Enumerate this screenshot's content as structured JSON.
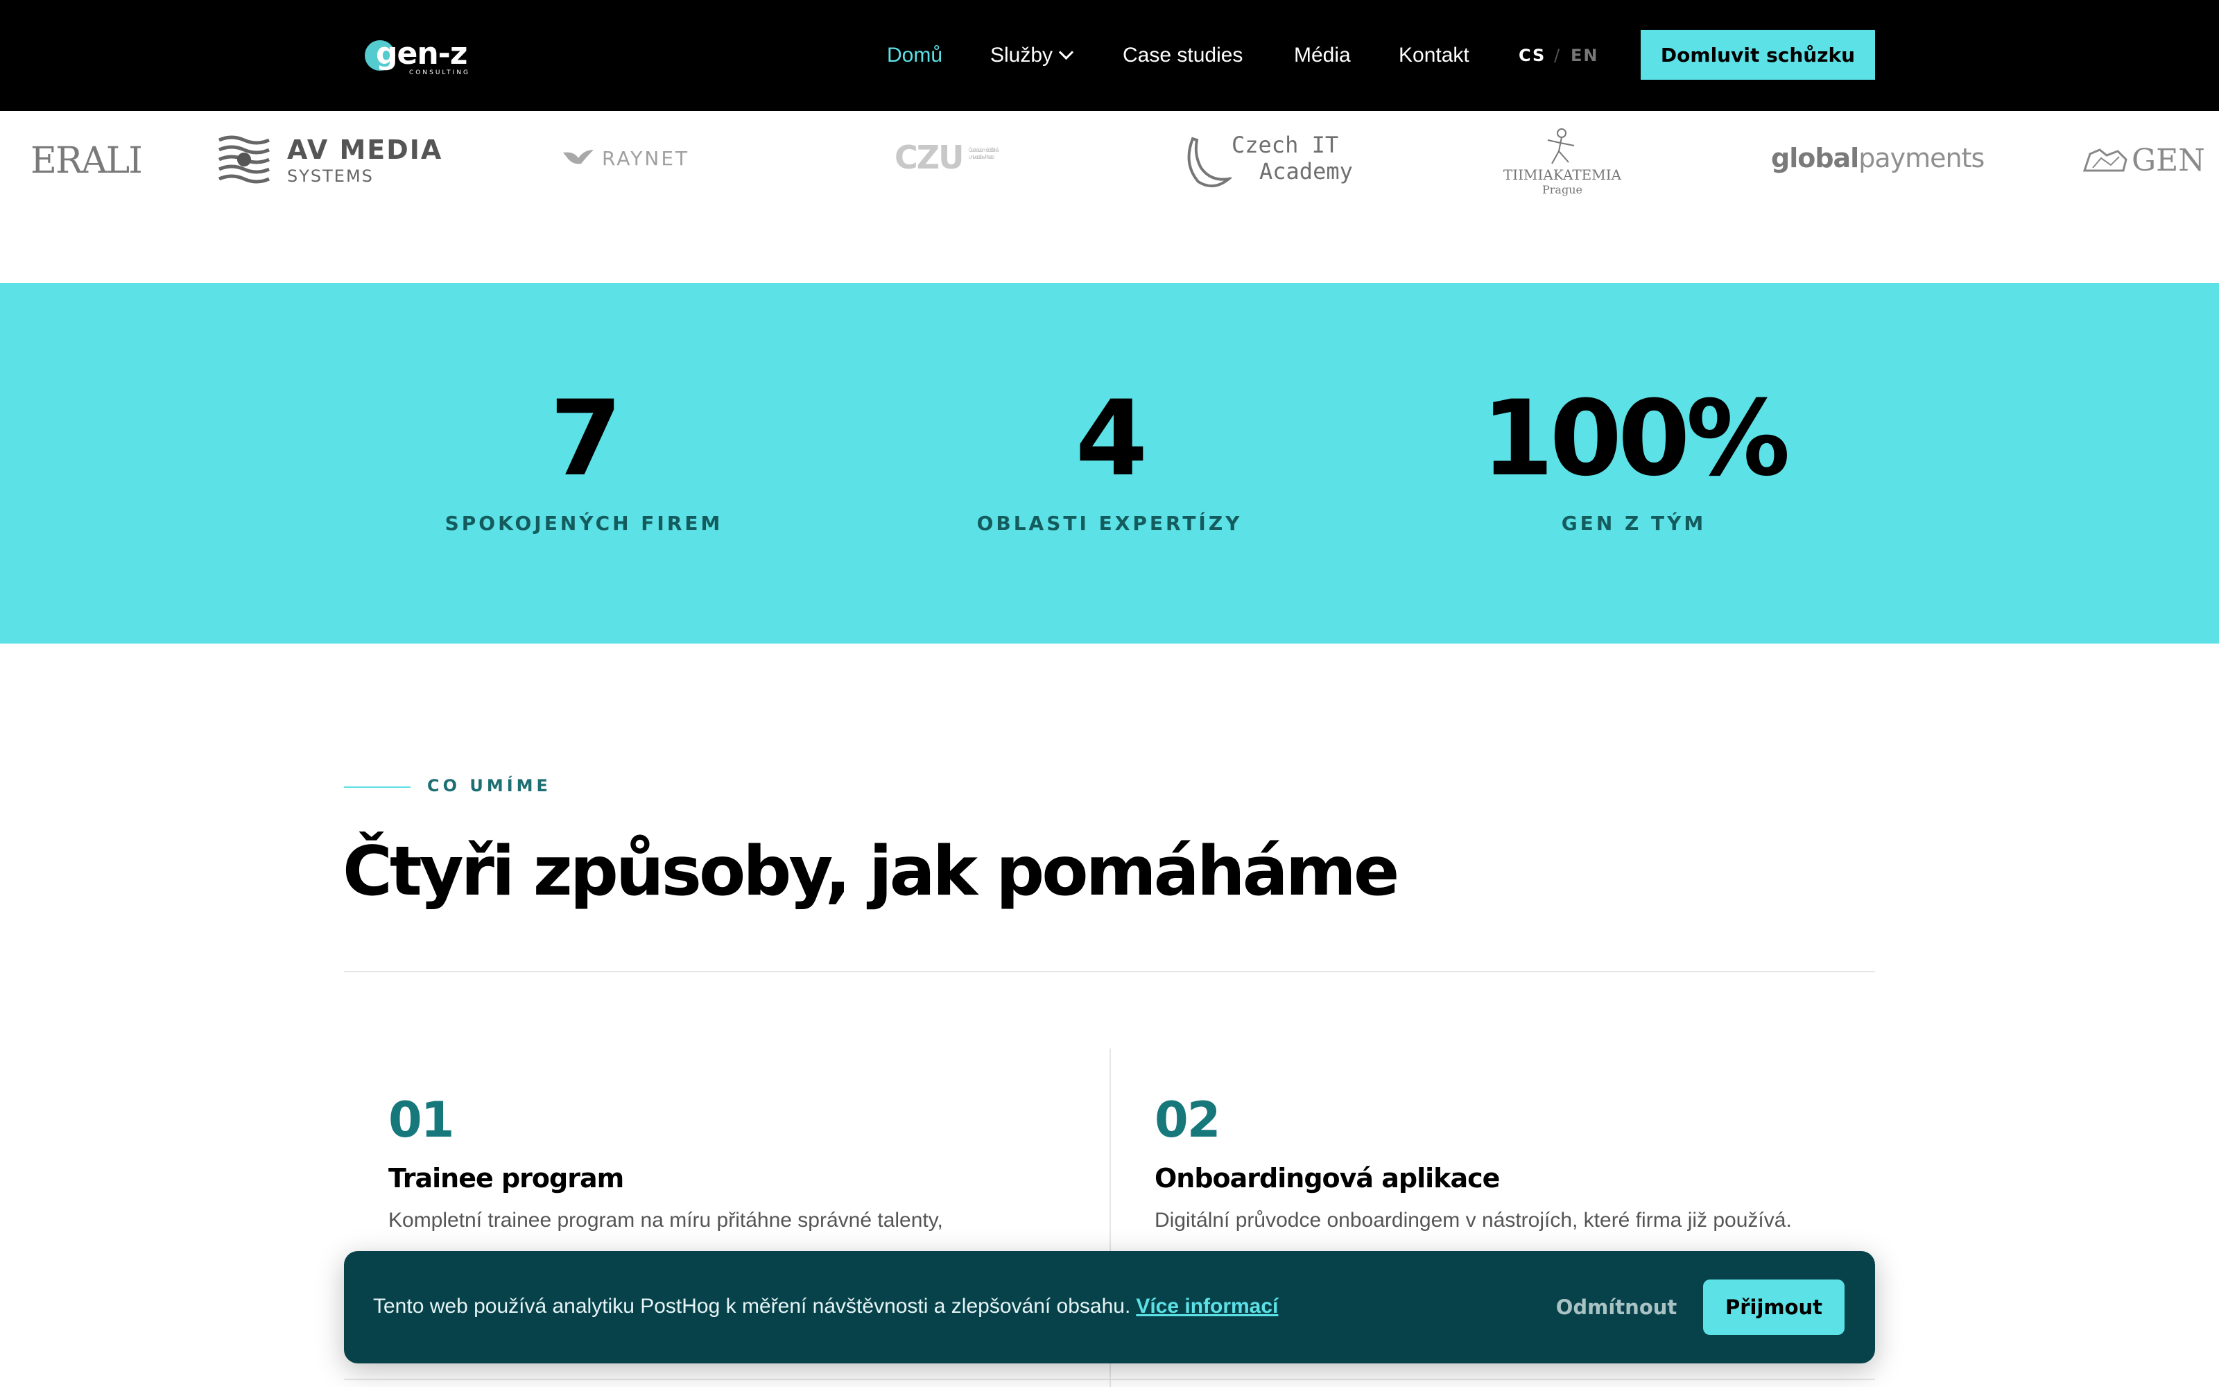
{
  "header": {
    "logo_text": "gen-z",
    "logo_sub": "CONSULTING",
    "nav": [
      {
        "label": "Domů",
        "active": true
      },
      {
        "label": "Služby",
        "dropdown": true
      },
      {
        "label": "Case studies"
      },
      {
        "label": "Média"
      },
      {
        "label": "Kontakt"
      }
    ],
    "lang_cs": "CS",
    "lang_sep": "/",
    "lang_en": "EN",
    "cta": "Domluvit schůzku"
  },
  "client_logos": {
    "generali_partial_left": "ERALI",
    "av_media_line1": "AV MEDIA",
    "av_media_line2": "SYSTEMS",
    "raynet": "RAYNET",
    "czu": "CZU",
    "czu_small": "Česká zemědělská univerzita v Praze",
    "czech_it_line1": "Czech IT",
    "czech_it_line2": "Academy",
    "tiimi_line1": "TIIMIAKATEMIA",
    "tiimi_line2": "Prague",
    "global_bold": "global",
    "global_rest": "payments",
    "generali_partial_right": "GEN"
  },
  "stats": [
    {
      "value": "7",
      "label": "SPOKOJENÝCH FIREM"
    },
    {
      "value": "4",
      "label": "OBLASTI EXPERTÍZY"
    },
    {
      "value": "100%",
      "label": "GEN Z TÝM"
    }
  ],
  "services": {
    "eyebrow": "CO UMÍME",
    "title": "Čtyři způsoby, jak pomáháme",
    "cards": [
      {
        "num": "01",
        "title": "Trainee program",
        "desc": "Kompletní trainee program na míru přitáhne správné talenty,"
      },
      {
        "num": "02",
        "title": "Onboardingová aplikace",
        "desc": "Digitální průvodce onboardingem v nástrojích, které firma již používá."
      }
    ]
  },
  "cookie": {
    "text": "Tento web používá analytiku PostHog k měření návštěvnosti a zlepšování obsahu.",
    "link": "Více informací",
    "decline": "Odmítnout",
    "accept": "Přijmout"
  },
  "colors": {
    "accent": "#5ce1e6",
    "header_bg": "#000000",
    "teal_dark": "#07424a",
    "teal_text": "#17787c"
  }
}
